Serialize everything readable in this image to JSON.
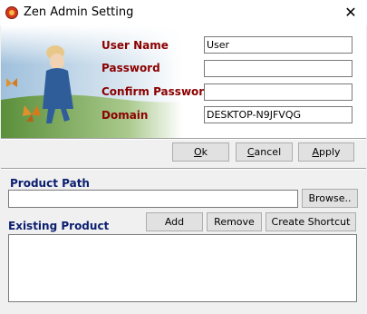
{
  "window": {
    "title": "Zen Admin Setting",
    "close_glyph": "✕"
  },
  "form": {
    "user_name_label": "User Name",
    "user_name_value": "User",
    "password_label": "Password",
    "password_value": "",
    "confirm_password_label": "Confirm Password",
    "confirm_password_value": "",
    "domain_label": "Domain",
    "domain_value": "DESKTOP-N9JFVQG",
    "label_color": "#8b0000"
  },
  "buttons": {
    "ok_mnemonic": "O",
    "ok_rest": "k",
    "cancel_mnemonic": "C",
    "cancel_rest": "ancel",
    "apply_mnemonic": "A",
    "apply_rest": "pply",
    "browse": "Browse..",
    "add": "Add",
    "remove": "Remove",
    "create_shortcut": "Create Shortcut"
  },
  "product": {
    "path_label": "Product Path",
    "path_value": "",
    "existing_label": "Existing Product",
    "items": [],
    "section_color": "#0b1f70"
  },
  "icons": {
    "app": "zen-app-icon",
    "close": "close-icon",
    "banner": "child-with-butterflies-illustration"
  }
}
